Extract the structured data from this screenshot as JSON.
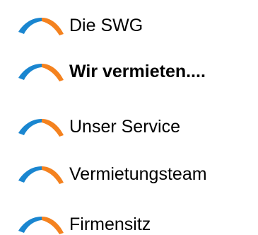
{
  "nav": {
    "items": [
      {
        "label": "Die SWG",
        "icon": "swg-logo-arc-icon",
        "active": false
      },
      {
        "label": "Wir vermieten....",
        "icon": "swg-logo-arc-icon",
        "active": true
      },
      {
        "label": "Unser Service",
        "icon": "swg-logo-arc-icon",
        "active": false
      },
      {
        "label": "Vermietungsteam",
        "icon": "swg-logo-arc-icon",
        "active": false
      },
      {
        "label": "Firmensitz",
        "icon": "swg-logo-arc-icon",
        "active": false
      }
    ]
  },
  "colors": {
    "icon_blue": "#1a86d0",
    "icon_orange": "#f4821f",
    "text": "#000000",
    "background": "#ffffff"
  }
}
